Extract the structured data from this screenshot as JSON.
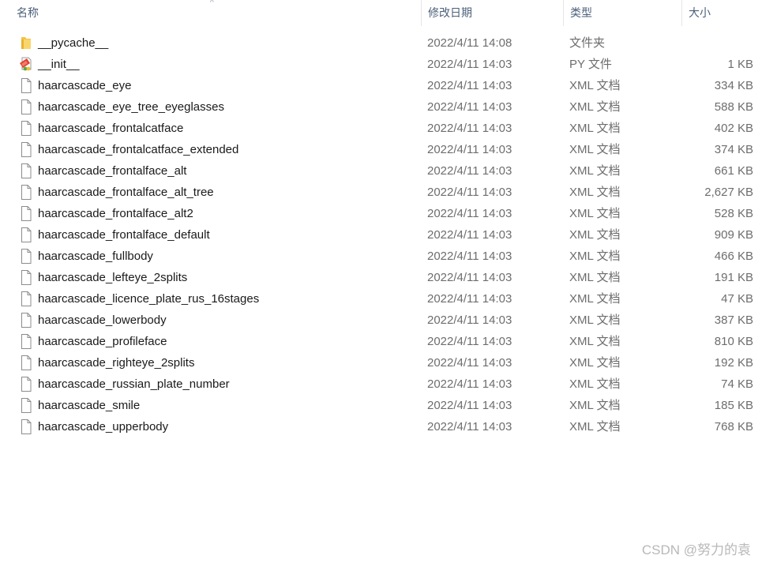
{
  "columns": {
    "name": "名称",
    "date": "修改日期",
    "type": "类型",
    "size": "大小",
    "sort_indicator": "^"
  },
  "files": [
    {
      "name": "__pycache__",
      "date": "2022/4/11 14:08",
      "type": "文件夹",
      "size": "",
      "icon": "folder-icon"
    },
    {
      "name": "__init__",
      "date": "2022/4/11 14:03",
      "type": "PY 文件",
      "size": "1 KB",
      "icon": "python-file-icon"
    },
    {
      "name": "haarcascade_eye",
      "date": "2022/4/11 14:03",
      "type": "XML 文档",
      "size": "334 KB",
      "icon": "file-icon"
    },
    {
      "name": "haarcascade_eye_tree_eyeglasses",
      "date": "2022/4/11 14:03",
      "type": "XML 文档",
      "size": "588 KB",
      "icon": "file-icon"
    },
    {
      "name": "haarcascade_frontalcatface",
      "date": "2022/4/11 14:03",
      "type": "XML 文档",
      "size": "402 KB",
      "icon": "file-icon"
    },
    {
      "name": "haarcascade_frontalcatface_extended",
      "date": "2022/4/11 14:03",
      "type": "XML 文档",
      "size": "374 KB",
      "icon": "file-icon"
    },
    {
      "name": "haarcascade_frontalface_alt",
      "date": "2022/4/11 14:03",
      "type": "XML 文档",
      "size": "661 KB",
      "icon": "file-icon"
    },
    {
      "name": "haarcascade_frontalface_alt_tree",
      "date": "2022/4/11 14:03",
      "type": "XML 文档",
      "size": "2,627 KB",
      "icon": "file-icon"
    },
    {
      "name": "haarcascade_frontalface_alt2",
      "date": "2022/4/11 14:03",
      "type": "XML 文档",
      "size": "528 KB",
      "icon": "file-icon"
    },
    {
      "name": "haarcascade_frontalface_default",
      "date": "2022/4/11 14:03",
      "type": "XML 文档",
      "size": "909 KB",
      "icon": "file-icon"
    },
    {
      "name": "haarcascade_fullbody",
      "date": "2022/4/11 14:03",
      "type": "XML 文档",
      "size": "466 KB",
      "icon": "file-icon"
    },
    {
      "name": "haarcascade_lefteye_2splits",
      "date": "2022/4/11 14:03",
      "type": "XML 文档",
      "size": "191 KB",
      "icon": "file-icon"
    },
    {
      "name": "haarcascade_licence_plate_rus_16stages",
      "date": "2022/4/11 14:03",
      "type": "XML 文档",
      "size": "47 KB",
      "icon": "file-icon"
    },
    {
      "name": "haarcascade_lowerbody",
      "date": "2022/4/11 14:03",
      "type": "XML 文档",
      "size": "387 KB",
      "icon": "file-icon"
    },
    {
      "name": "haarcascade_profileface",
      "date": "2022/4/11 14:03",
      "type": "XML 文档",
      "size": "810 KB",
      "icon": "file-icon"
    },
    {
      "name": "haarcascade_righteye_2splits",
      "date": "2022/4/11 14:03",
      "type": "XML 文档",
      "size": "192 KB",
      "icon": "file-icon"
    },
    {
      "name": "haarcascade_russian_plate_number",
      "date": "2022/4/11 14:03",
      "type": "XML 文档",
      "size": "74 KB",
      "icon": "file-icon"
    },
    {
      "name": "haarcascade_smile",
      "date": "2022/4/11 14:03",
      "type": "XML 文档",
      "size": "185 KB",
      "icon": "file-icon"
    },
    {
      "name": "haarcascade_upperbody",
      "date": "2022/4/11 14:03",
      "type": "XML 文档",
      "size": "768 KB",
      "icon": "file-icon"
    }
  ],
  "watermark": "CSDN @努力的袁",
  "colors": {
    "header_text": "#4c607a",
    "name_text": "#1a1a1a",
    "meta_text": "#6d6d6d",
    "folder": "#f5c342",
    "watermark": "#b8b8b8"
  }
}
